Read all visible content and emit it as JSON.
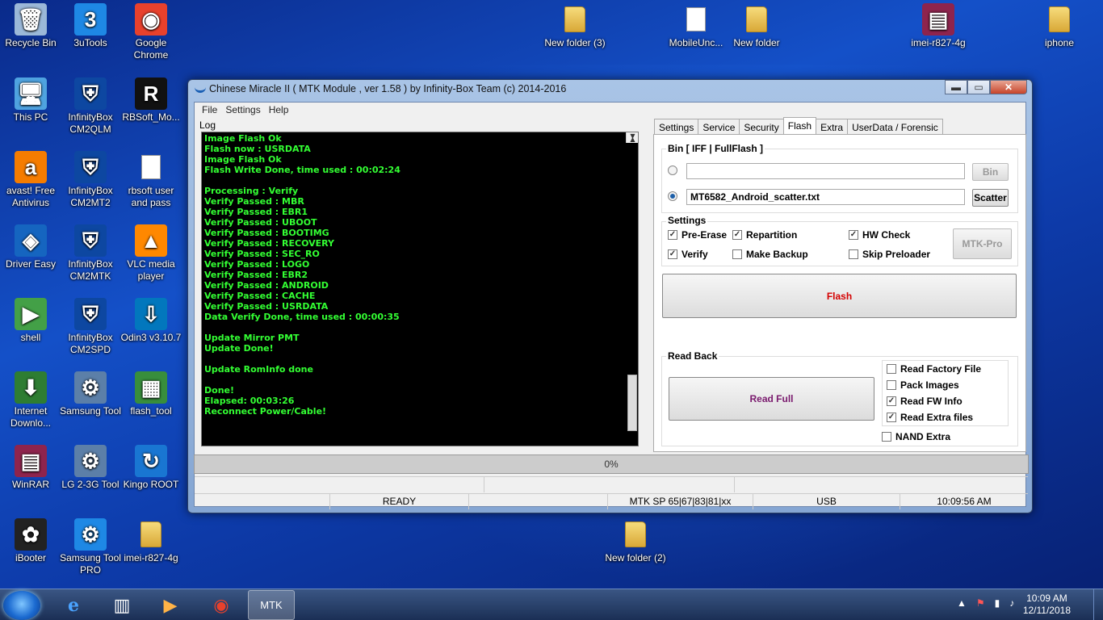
{
  "desktop": {
    "icons": [
      {
        "label": "Recycle Bin",
        "glyph": "🗑",
        "icon": "recycle-bin-icon"
      },
      {
        "label": "3uTools",
        "glyph": "3",
        "icon": "3utools-icon"
      },
      {
        "label": "Google Chrome",
        "glyph": "◉",
        "icon": "chrome-icon"
      },
      {
        "label": "This PC",
        "glyph": "🖥",
        "icon": "pc-icon"
      },
      {
        "label": "InfinityBox CM2QLM",
        "glyph": "⛨",
        "icon": "infinitybox-icon"
      },
      {
        "label": "RBSoft_Mo...",
        "glyph": "R",
        "icon": "rbsoft-icon"
      },
      {
        "label": "avast! Free Antivirus",
        "glyph": "a",
        "icon": "avast-icon"
      },
      {
        "label": "InfinityBox CM2MT2",
        "glyph": "⛨",
        "icon": "infinitybox-icon"
      },
      {
        "label": "rbsoft user and pass",
        "glyph": "",
        "icon": "document-icon"
      },
      {
        "label": "Driver Easy",
        "glyph": "◈",
        "icon": "driver-easy-icon"
      },
      {
        "label": "InfinityBox CM2MTK",
        "glyph": "⛨",
        "icon": "infinitybox-icon"
      },
      {
        "label": "VLC media player",
        "glyph": "▲",
        "icon": "vlc-icon"
      },
      {
        "label": "shell",
        "glyph": "▶",
        "icon": "shell-icon"
      },
      {
        "label": "InfinityBox CM2SPD",
        "glyph": "⛨",
        "icon": "infinitybox-icon"
      },
      {
        "label": "Odin3 v3.10.7",
        "glyph": "⇩",
        "icon": "odin-icon"
      },
      {
        "label": "Internet Downlo...",
        "glyph": "⬇",
        "icon": "idm-icon"
      },
      {
        "label": "Samsung Tool",
        "glyph": "⚙",
        "icon": "samsung-tool-icon"
      },
      {
        "label": "flash_tool",
        "glyph": "▦",
        "icon": "flash-tool-icon"
      },
      {
        "label": "WinRAR",
        "glyph": "▤",
        "icon": "winrar-icon"
      },
      {
        "label": "LG 2-3G Tool",
        "glyph": "⚙",
        "icon": "lg-tool-icon"
      },
      {
        "label": "Kingo ROOT",
        "glyph": "↻",
        "icon": "kingo-root-icon"
      },
      {
        "label": "iBooter",
        "glyph": "✿",
        "icon": "ibooter-icon"
      },
      {
        "label": "Samsung Tool PRO",
        "glyph": "⚙",
        "icon": "samsung-tool-pro-icon"
      },
      {
        "label": "imei-r827-4g",
        "glyph": "",
        "icon": "folder-icon"
      },
      {
        "label": "New folder (3)",
        "glyph": "",
        "icon": "folder-icon"
      },
      {
        "label": "MobileUnc...",
        "glyph": "",
        "icon": "document-icon"
      },
      {
        "label": "New folder",
        "glyph": "",
        "icon": "folder-icon"
      },
      {
        "label": "imei-r827-4g",
        "glyph": "▤",
        "icon": "winrar-archive-icon"
      },
      {
        "label": "iphone",
        "glyph": "",
        "icon": "folder-icon"
      },
      {
        "label": "New folder (2)",
        "glyph": "",
        "icon": "folder-icon"
      }
    ]
  },
  "window": {
    "title": "Chinese Miracle II ( MTK Module , ver 1.58 ) by Infinity-Box Team (c) 2014-2016",
    "controls": {
      "minimize": "▬",
      "maximize": "▭",
      "close": "✕"
    },
    "menu": [
      "File",
      "Settings",
      "Help"
    ],
    "log_label": "Log",
    "log_lines": [
      "Image Flash Ok",
      "Flash now : USRDATA",
      "Image Flash Ok",
      "Flash Write Done, time used : 00:02:24",
      "",
      "Processing : Verify",
      "Verify Passed : MBR",
      "Verify Passed : EBR1",
      "Verify Passed : UBOOT",
      "Verify Passed : BOOTIMG",
      "Verify Passed : RECOVERY",
      "Verify Passed : SEC_RO",
      "Verify Passed : LOGO",
      "Verify Passed : EBR2",
      "Verify Passed : ANDROID",
      "Verify Passed : CACHE",
      "Verify Passed : USRDATA",
      "Data Verify Done, time used : 00:00:35",
      "",
      "Update Mirror PMT",
      "Update Done!",
      "",
      "Update RomInfo done",
      "",
      "Done!",
      "Elapsed: 00:03:26",
      "Reconnect Power/Cable!"
    ],
    "tabs": [
      "Settings",
      "Service",
      "Security",
      "Flash",
      "Extra",
      "UserData / Forensic"
    ],
    "active_tab": "Flash",
    "bin_group": {
      "label": "Bin  [ IFF | FullFlash ]",
      "bin_value": "",
      "bin_button": "Bin",
      "scatter_value": "MT6582_Android_scatter.txt",
      "scatter_button": "Scatter"
    },
    "settings_group": {
      "label": "Settings",
      "checks": [
        {
          "label": "Pre-Erase",
          "checked": true
        },
        {
          "label": "Repartition",
          "checked": true
        },
        {
          "label": "HW Check",
          "checked": true
        },
        {
          "label": "Verify",
          "checked": true
        },
        {
          "label": "Make Backup",
          "checked": false
        },
        {
          "label": "Skip Preloader",
          "checked": false
        }
      ],
      "mtk_pro": "MTK-Pro"
    },
    "flash_button": "Flash",
    "flash_color": "#d40000",
    "readback": {
      "label": "Read Back",
      "button": "Read Full",
      "button_color": "#7a1a6e",
      "checks": [
        {
          "label": "Read Factory File",
          "checked": false
        },
        {
          "label": "Pack Images",
          "checked": false
        },
        {
          "label": "Read FW Info",
          "checked": true
        },
        {
          "label": "Read Extra files",
          "checked": true
        }
      ],
      "nand": {
        "label": "NAND Extra",
        "checked": false
      }
    },
    "progress": "0%",
    "status": {
      "state": "READY",
      "chip": "MTK SP 65|67|83|81|xx",
      "port": "USB",
      "time": "10:09:56 AM"
    }
  },
  "taskbar": {
    "apps": [
      "ie",
      "explorer",
      "media-player",
      "chrome",
      "cm2"
    ],
    "clock_time": "10:09 AM",
    "clock_date": "12/11/2018"
  }
}
